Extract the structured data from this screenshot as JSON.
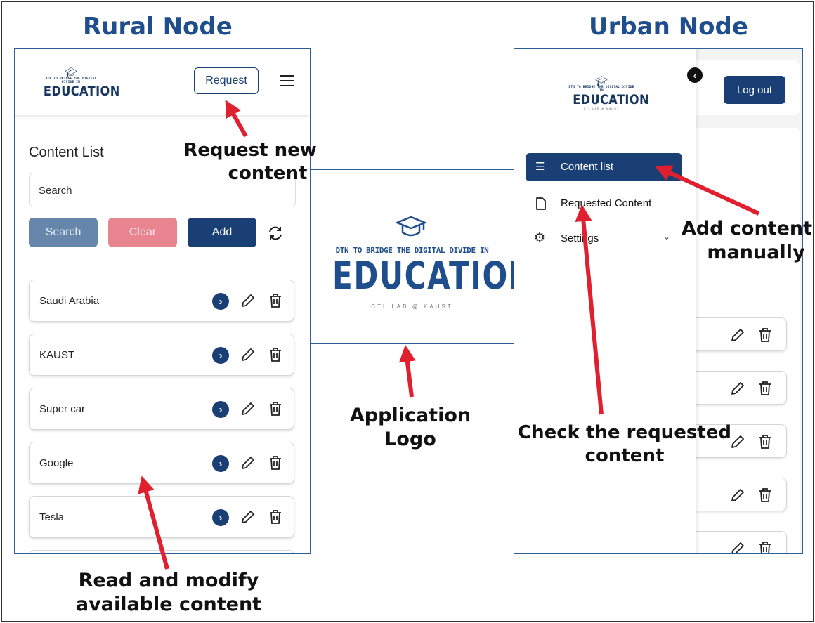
{
  "titles": {
    "rural": "Rural Node",
    "urban": "Urban Node"
  },
  "logo": {
    "tagline": "DTN TO BRIDGE THE DIGITAL DIVIDE IN",
    "word": "EDUCATION",
    "sub": "CTL LAB @ KAUST"
  },
  "rural": {
    "request_button": "Request",
    "heading": "Content List",
    "search_placeholder": "Search",
    "buttons": {
      "search": "Search",
      "clear": "Clear",
      "add": "Add"
    },
    "items": [
      "Saudi Arabia",
      "KAUST",
      "Super car",
      "Google",
      "Tesla"
    ]
  },
  "urban": {
    "logout_button": "Log out",
    "menu": {
      "content_list": "Content list",
      "requested_content": "Requested Content",
      "settings": "Settings"
    }
  },
  "annotations": {
    "request_new_1": "Request new",
    "request_new_2": "content",
    "app_logo_1": "Application",
    "app_logo_2": "Logo",
    "read_modify_1": "Read and modify",
    "read_modify_2": "available content",
    "add_manual_1": "Add content",
    "add_manual_2": "manually",
    "check_req_1": "Check the requested",
    "check_req_2": "content"
  },
  "colors": {
    "title_blue": "#1f4e8c",
    "navy": "#1a3f75",
    "search_btn": "#6786ab",
    "clear_btn": "#e98591",
    "arrow_red": "#e0202e"
  }
}
